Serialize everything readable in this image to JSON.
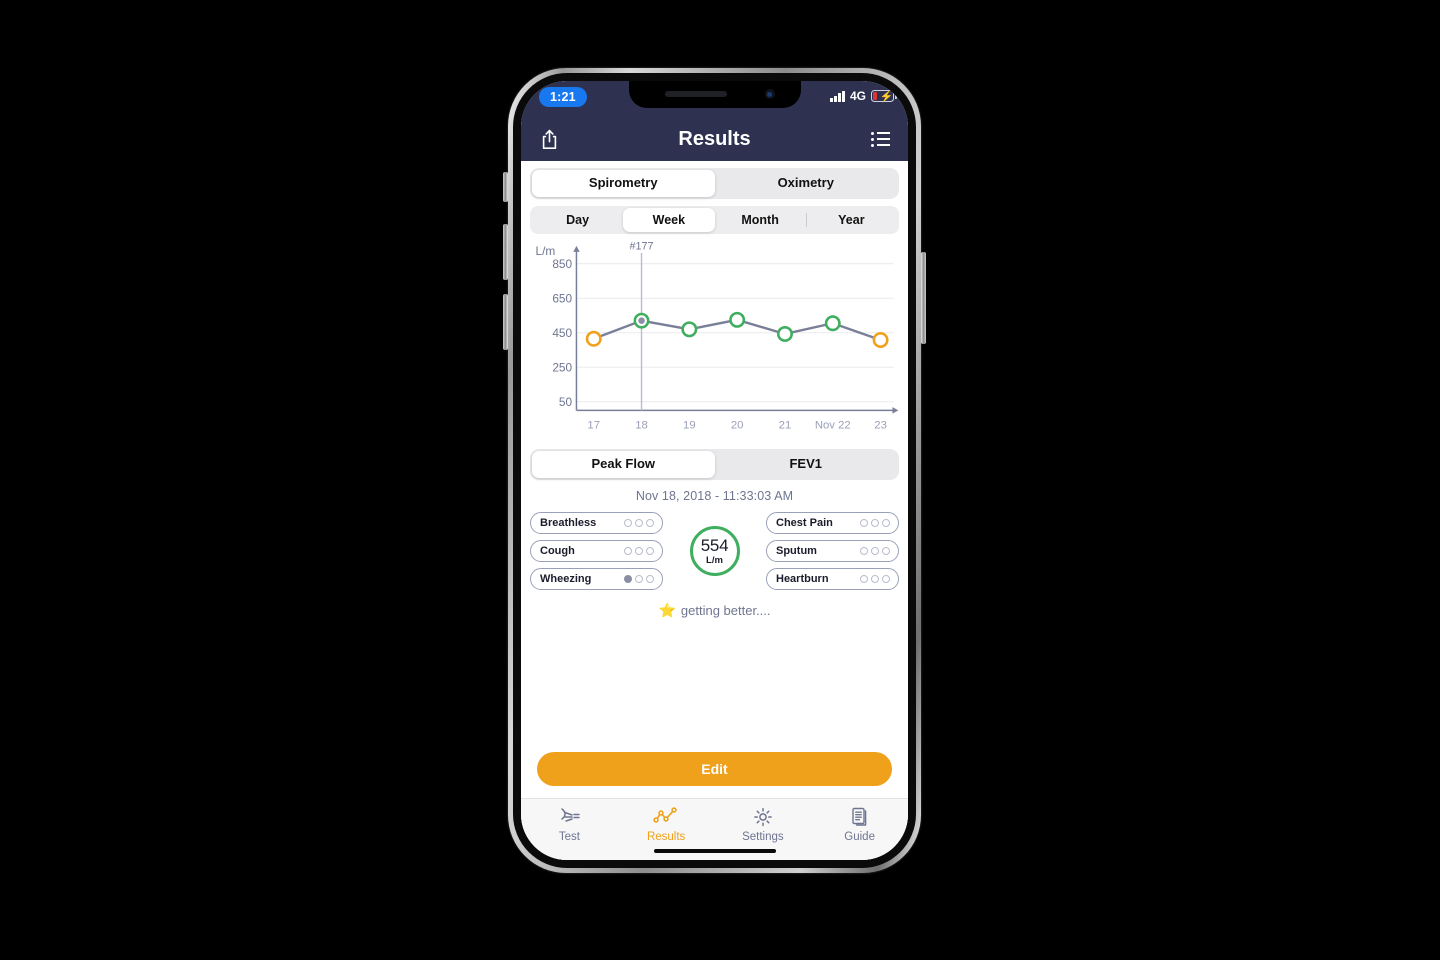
{
  "statusbar": {
    "time": "1:21",
    "network": "4G",
    "signal_icon": "signal-bars-icon",
    "battery_icon": "battery-charging-icon"
  },
  "navbar": {
    "title": "Results",
    "share_icon": "share-icon",
    "list_icon": "list-menu-icon"
  },
  "mode_tabs": [
    {
      "label": "Spirometry",
      "active": true
    },
    {
      "label": "Oximetry",
      "active": false
    }
  ],
  "range_tabs": [
    {
      "label": "Day",
      "active": false
    },
    {
      "label": "Week",
      "active": true
    },
    {
      "label": "Month",
      "active": false
    },
    {
      "label": "Year",
      "active": false
    }
  ],
  "metric_tabs": [
    {
      "label": "Peak Flow",
      "active": true
    },
    {
      "label": "FEV1",
      "active": false
    }
  ],
  "timestamp": "Nov 18, 2018 - 11:33:03 AM",
  "chart_data": {
    "type": "line",
    "title": "",
    "xlabel": "",
    "ylabel": "L/m",
    "ylim": [
      50,
      850
    ],
    "yticks": [
      850,
      650,
      450,
      250,
      50
    ],
    "grid": true,
    "legend": "none",
    "categories": [
      "17",
      "18",
      "19",
      "20",
      "21",
      "Nov 22",
      "23"
    ],
    "values": [
      415,
      520,
      470,
      525,
      443,
      505,
      408
    ],
    "point_colors": [
      "#efa11b",
      "#3fae5f",
      "#3fae5f",
      "#3fae5f",
      "#3fae5f",
      "#3fae5f",
      "#efa11b"
    ],
    "selected_index": 1,
    "selected_annotation": "#177",
    "line_color": "#7a7f99"
  },
  "score": {
    "value": "554",
    "unit": "L/m",
    "ring_color": "#3fae5f"
  },
  "symptoms_left": [
    {
      "label": "Breathless",
      "filled": 0,
      "total": 3
    },
    {
      "label": "Cough",
      "filled": 0,
      "total": 3
    },
    {
      "label": "Wheezing",
      "filled": 1,
      "total": 3
    }
  ],
  "symptoms_right": [
    {
      "label": "Chest Pain",
      "filled": 0,
      "total": 3
    },
    {
      "label": "Sputum",
      "filled": 0,
      "total": 3
    },
    {
      "label": "Heartburn",
      "filled": 0,
      "total": 3
    }
  ],
  "note": {
    "star": "⭐",
    "text": "getting better...."
  },
  "edit_button": {
    "label": "Edit",
    "color": "#efa11b"
  },
  "tabbar": [
    {
      "label": "Test",
      "icon": "blow-test-icon",
      "active": false
    },
    {
      "label": "Results",
      "icon": "line-chart-icon",
      "active": true
    },
    {
      "label": "Settings",
      "icon": "gear-icon",
      "active": false
    },
    {
      "label": "Guide",
      "icon": "documents-icon",
      "active": false
    }
  ]
}
